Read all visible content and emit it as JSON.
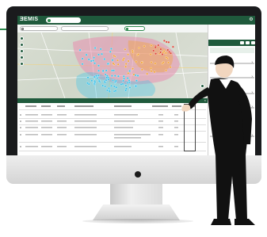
{
  "app": {
    "logo_text": "ƎEMIS",
    "top_pill_label": "",
    "user_label": "",
    "settings_icon": "gear-icon"
  },
  "search": {
    "input_value": "",
    "select_value": "",
    "filter_label": ""
  },
  "panel": {
    "header_label": "",
    "subheader_label": ""
  },
  "table": {
    "title": "",
    "columns": [],
    "rows": []
  },
  "colors": {
    "brand_green": "#1f5a3c",
    "accent_green": "#2e8a4e",
    "bezel": "#1a1b1d",
    "marker_blue": "#3cc2e8",
    "marker_orange": "#f2a33a",
    "zone_pink": "#e88fb0"
  }
}
